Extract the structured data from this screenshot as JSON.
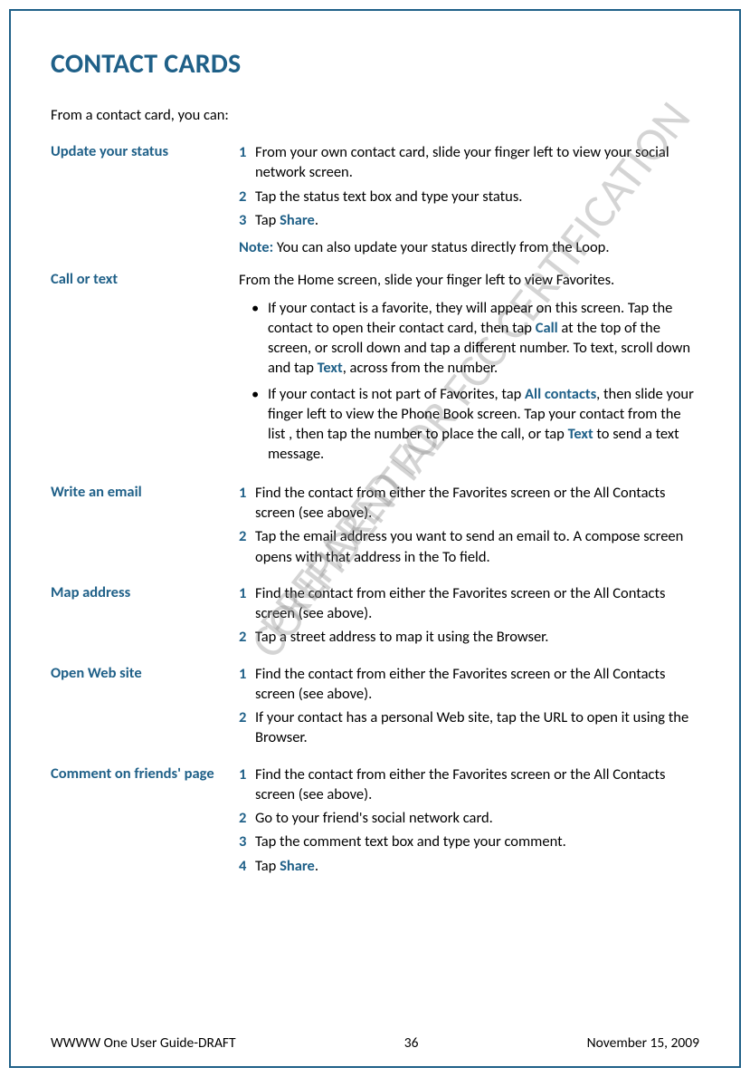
{
  "title": "CONTACT CARDS",
  "intro": "From a contact card, you can:",
  "watermark1": "PREPARED FOR FCC CERTIFICATION",
  "watermark2": "CONFIDENTIAL",
  "sections": {
    "update_status": {
      "label": "Update your status",
      "s1a": "From your own contact card, slide your finger left to view your social network screen.",
      "s2a": "Tap the status text box and type your status.",
      "s3a": "Tap ",
      "s3b": "Share",
      "s3c": ".",
      "noteLabel": "Note:",
      "noteText": " You can also update your status directly from the Loop."
    },
    "call_text": {
      "label": "Call or text",
      "lead": "From the Home screen, slide your finger left to view Favorites.",
      "b1a": "If your contact is a favorite, they will appear on this screen. Tap the contact to open their contact card, then tap ",
      "b1b": "Call",
      "b1c": " at the top of the screen, or scroll down and tap a different number. To text, scroll down and tap ",
      "b1d": "Text",
      "b1e": ", across from the number.",
      "b2a": "If your contact is not part of Favorites, tap ",
      "b2b": "All contacts",
      "b2c": ", then slide your finger left to view the Phone Book screen. Tap your contact from the list , then tap the number to place the call, or tap ",
      "b2d": "Text",
      "b2e": " to send a text message."
    },
    "write_email": {
      "label": "Write an email",
      "s1": "Find the contact from either the Favorites screen or the All Contacts screen (see above).",
      "s2": "Tap the email address you want to send an email to. A compose screen opens with that address in the To field."
    },
    "map_address": {
      "label": "Map address",
      "s1": "Find the contact from either the Favorites screen or the All Contacts screen (see above).",
      "s2": "Tap a street address to map it using the Browser."
    },
    "open_web": {
      "label": "Open Web site",
      "s1": "Find the contact from either the Favorites screen or the All Contacts screen (see above).",
      "s2": "If your contact has a personal Web site, tap the URL to open it using the Browser."
    },
    "comment": {
      "label": "Comment on friends' page",
      "s1": "Find the contact from either the Favorites screen or the All Contacts screen (see above).",
      "s2": "Go to your friend's social network card.",
      "s3": "Tap the comment text box and type your comment.",
      "s4a": "Tap ",
      "s4b": "Share",
      "s4c": "."
    }
  },
  "footer": {
    "left": "WWWW One User Guide-DRAFT",
    "center": "36",
    "right": "November 15, 2009"
  },
  "nums": {
    "n1": "1",
    "n2": "2",
    "n3": "3",
    "n4": "4"
  }
}
